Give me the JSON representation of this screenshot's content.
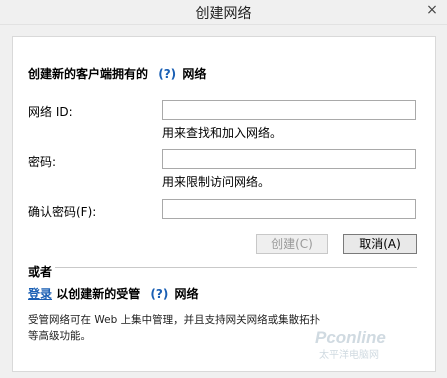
{
  "window": {
    "title": "创建网络",
    "close_glyph": "×"
  },
  "section1": {
    "heading": "创建新的客户端拥有的",
    "help_link": "(?)",
    "heading_suffix": "网络"
  },
  "form": {
    "network_id": {
      "label": "网络 ID:",
      "value": "",
      "hint": "用来查找和加入网络。"
    },
    "password": {
      "label": "密码:",
      "value": "",
      "hint": "用来限制访问网络。"
    },
    "confirm": {
      "label": "确认密码(F):",
      "value": ""
    }
  },
  "buttons": {
    "create": "创建(C)",
    "cancel": "取消(A)"
  },
  "section2": {
    "or_label": "或者",
    "login_link": "登录",
    "text_mid": "以创建新的受管",
    "help_link": "(?)",
    "text_suffix": "网络",
    "description": "受管网络可在 Web 上集中管理，并且支持网关网络或集散拓扑等高级功能。"
  },
  "watermark": {
    "brand": "Pconline",
    "sub": "太平洋电脑网"
  },
  "colors": {
    "link": "#1a5fb4",
    "background": "#f0f0f0",
    "panel": "#ffffff"
  }
}
